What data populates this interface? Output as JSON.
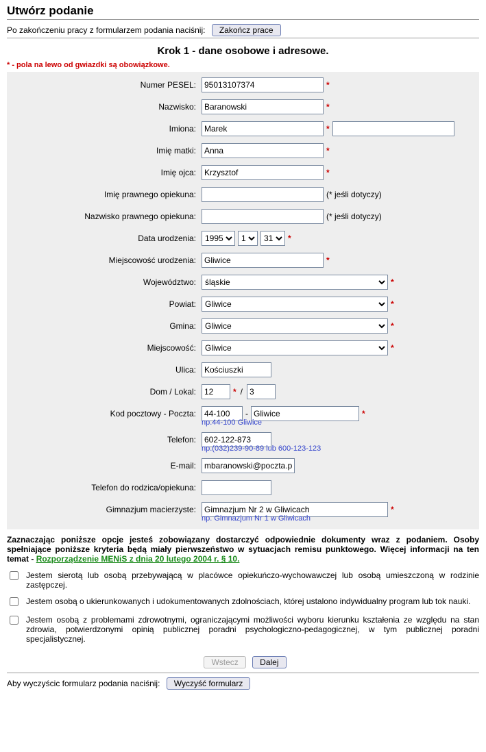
{
  "header": {
    "title": "Utwórz podanie",
    "instruction": "Po zakończeniu pracy z formularzem podania naciśnij:",
    "finish_button": "Zakończ prace"
  },
  "step": {
    "heading": "Krok 1 - dane osobowe i adresowe.",
    "required_note": "* - pola na lewo od gwiazdki są obowiązkowe."
  },
  "labels": {
    "pesel": "Numer PESEL:",
    "surname": "Nazwisko:",
    "names": "Imiona:",
    "mother": "Imię matki:",
    "father": "Imię ojca:",
    "guardian_first": "Imię prawnego opiekuna:",
    "guardian_last": "Nazwisko prawnego opiekuna:",
    "birth_date": "Data urodzenia:",
    "birth_place": "Miejscowość urodzenia:",
    "province": "Województwo:",
    "district": "Powiat:",
    "commune": "Gmina:",
    "locality": "Miejscowość:",
    "street": "Ulica:",
    "house": "Dom / Lokal:",
    "postcode": "Kod pocztowy - Poczta:",
    "phone": "Telefon:",
    "email": "E-mail:",
    "guardian_phone": "Telefon do rodzica/opiekuna:",
    "school": "Gimnazjum macierzyste:",
    "if_applies": "(* jeśli dotyczy)"
  },
  "values": {
    "pesel": "95013107374",
    "surname": "Baranowski",
    "names1": "Marek",
    "names2": "",
    "mother": "Anna",
    "father": "Krzysztof",
    "guardian_first": "",
    "guardian_last": "",
    "birth_year": "1995",
    "birth_month": "1",
    "birth_day": "31",
    "birth_place": "Gliwice",
    "province": "śląskie",
    "district": "Gliwice",
    "commune": "Gliwice",
    "locality": "Gliwice",
    "street": "Kościuszki",
    "house": "12",
    "apt": "3",
    "postcode": "44-100",
    "post_city": "Gliwice",
    "phone": "602-122-873",
    "email": "mbaranowski@poczta.pl",
    "guardian_phone": "",
    "school": "Gimnazjum Nr 2 w Gliwicach"
  },
  "hints": {
    "postcode": "np.44-100 Gliwice",
    "phone": "np.(032)239-90-89 lub 600-123-123",
    "school": "np. Gimnazjum Nr 1 w Gliwicach"
  },
  "options": {
    "intro_pre": "Zaznaczając poniższe opcje jesteś zobowiązany dostarczyć odpowiednie dokumenty wraz z podaniem. Osoby spełniające poniższe kryteria będą miały pierwszeństwo w sytuacjach remisu punktowego. Więcej informacji na ten temat - ",
    "intro_link": "Rozporządzenie MENiS z dnia 20 lutego 2004 r. § 10.",
    "opt1": "Jestem sierotą lub osobą przebywającą w placówce opiekuńczo-wychowawczej lub osobą umieszczoną w rodzinie zastępczej.",
    "opt2": "Jestem osobą o ukierunkowanych i udokumentowanych zdolnościach, której ustalono indywidualny program lub tok nauki.",
    "opt3": "Jestem osobą z problemami zdrowotnymi, ograniczającymi możliwości wyboru kierunku kształenia ze względu na stan zdrowia, potwierdzonymi opinią publicznej poradni psychologiczno-pedagogicznej, w tym publicznej poradni specjalistycznej."
  },
  "nav": {
    "back": "Wstecz",
    "next": "Dalej"
  },
  "footer": {
    "clear_instr": "Aby wyczyścic formularz podania naciśnij:",
    "clear_button": "Wyczyść formularz"
  }
}
